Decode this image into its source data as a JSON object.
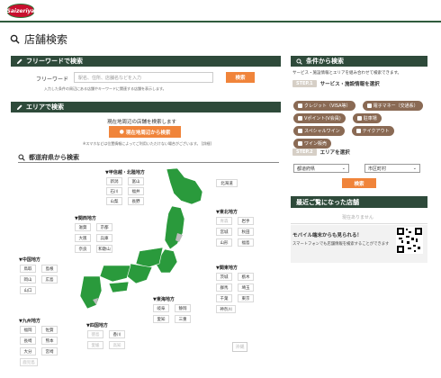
{
  "brand": {
    "logo_text": "Saizeriya"
  },
  "page": {
    "title": "店舗検索"
  },
  "freeword": {
    "header": "フリーワードで検索",
    "label": "フリーワード",
    "placeholder": "駅名、住所、店舗名などを入力",
    "search_button": "検索",
    "note": "入力した条件の周辺にある店舗やキーワードに関連する店舗を表示します。"
  },
  "area": {
    "header": "エリアで検索",
    "nearby_text": "現在地周辺の店舗を検索します",
    "nearby_button": "現在地周辺から検索",
    "nearby_note": "※スマホなどは位置情報によってご利用いただけない場合がございます。 [詳細]"
  },
  "pref": {
    "header": "都道府県から検索"
  },
  "regions": {
    "hokkaido_tohoku_n": {
      "title": "▼甲信越・北陸地方",
      "prefs": [
        "新潟",
        "富山",
        "石川",
        "福井",
        "山梨",
        "長野"
      ]
    },
    "hokkaido": {
      "prefs": [
        "北海道"
      ]
    },
    "tohoku": {
      "title": "▼東北地方",
      "prefs": [
        "青森",
        "岩手",
        "宮城",
        "秋田",
        "山形",
        "福島"
      ]
    },
    "kansai": {
      "title": "▼関西地方",
      "prefs": [
        "滋賀",
        "京都",
        "大阪",
        "兵庫",
        "奈良",
        "和歌山"
      ]
    },
    "kanto": {
      "title": "▼関東地方",
      "prefs": [
        "茨城",
        "栃木",
        "群馬",
        "埼玉",
        "千葉",
        "東京",
        "神奈川"
      ]
    },
    "chugoku": {
      "title": "▼中国地方",
      "prefs": [
        "鳥取",
        "島根",
        "岡山",
        "広島",
        "山口"
      ]
    },
    "tokai": {
      "title": "▼東海地方",
      "prefs": [
        "岐阜",
        "静岡",
        "愛知",
        "三重"
      ]
    },
    "kyushu": {
      "title": "▼九州地方",
      "prefs": [
        "福岡",
        "佐賀",
        "長崎",
        "熊本",
        "大分",
        "宮崎",
        "鹿児島"
      ]
    },
    "shikoku": {
      "title": "▼四国地方",
      "prefs": [
        "徳島",
        "香川",
        "愛媛",
        "高知"
      ]
    },
    "okinawa": {
      "prefs": [
        "沖縄"
      ]
    }
  },
  "conditions": {
    "header": "条件から検索",
    "desc": "サービス・施設情報とエリアを組み合わせて検索できます。",
    "step1_badge": "STEP.1",
    "step1_label": "サービス・施設情報を選択",
    "chips": [
      "クレジット（VISA等）",
      "電子マネー（交通系）",
      "Vポイント(V会員)",
      "駐車場",
      "スペシャルワイン",
      "テイクアウト",
      "ワイン販売"
    ],
    "step2_badge": "STEP.2",
    "step2_label": "エリアを選択",
    "select_pref": "都道府県",
    "select_city": "市区町村",
    "search_button": "検索"
  },
  "recent": {
    "header": "最近ご覧になった店舗",
    "empty": "現在ありません"
  },
  "mobile": {
    "title": "モバイル端末からも見られる！",
    "desc": "スマートフォンでも店舗情報を検索することができます"
  },
  "colors": {
    "header_bg": "#2e4a3a",
    "accent": "#f0843a",
    "map_green": "#2a9a3c",
    "chip": "#8a6a54"
  }
}
